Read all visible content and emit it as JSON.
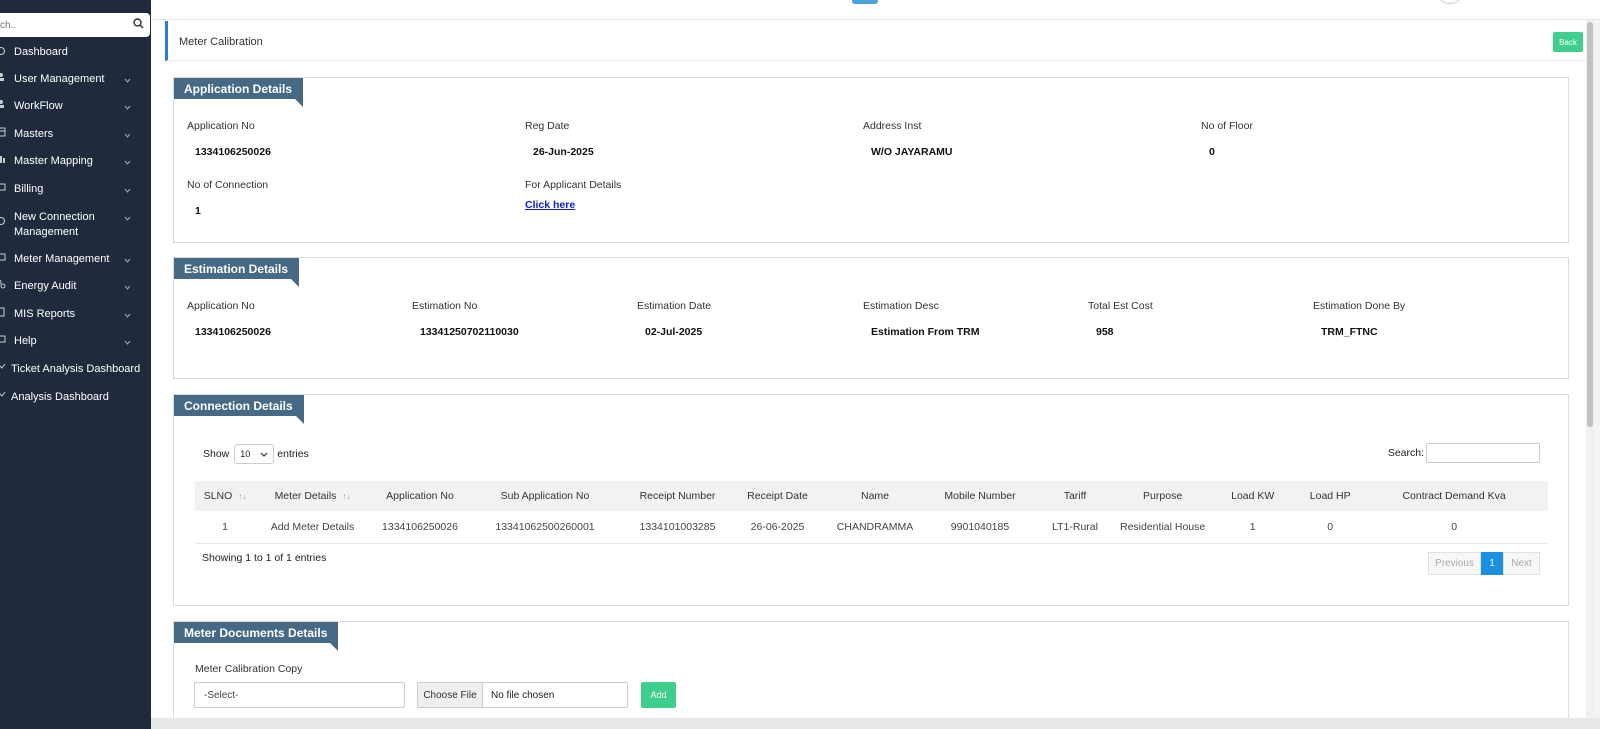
{
  "sidebar": {
    "search_placeholder": "ch..",
    "items": [
      {
        "label": "Dashboard",
        "icon": "dashboard-icon",
        "chevron": false
      },
      {
        "label": "User Management",
        "icon": "users-icon",
        "chevron": true
      },
      {
        "label": "WorkFlow",
        "icon": "workflow-icon",
        "chevron": true
      },
      {
        "label": "Masters",
        "icon": "table-icon",
        "chevron": true
      },
      {
        "label": "Master Mapping",
        "icon": "mapping-icon",
        "chevron": true
      },
      {
        "label": "Billing",
        "icon": "billing-icon",
        "chevron": true
      },
      {
        "label": "New Connection Management",
        "icon": "connection-icon",
        "chevron": true
      },
      {
        "label": "Meter Management",
        "icon": "meter-icon",
        "chevron": true
      },
      {
        "label": "Energy Audit",
        "icon": "audit-icon",
        "chevron": true
      },
      {
        "label": "MIS Reports",
        "icon": "reports-icon",
        "chevron": true
      },
      {
        "label": "Help",
        "icon": "help-icon",
        "chevron": true
      },
      {
        "label": "Ticket Analysis Dashboard",
        "icon": "ticket-icon",
        "chevron": false
      },
      {
        "label": "Analysis Dashboard",
        "icon": "chart-icon",
        "chevron": false
      }
    ]
  },
  "page": {
    "title": "Meter Calibration",
    "back_label": "Back"
  },
  "application": {
    "header": "Application Details",
    "app_no_label": "Application No",
    "app_no": "1334106250026",
    "reg_date_label": "Reg Date",
    "reg_date": "26-Jun-2025",
    "address_label": "Address Inst",
    "address": "W/O JAYARAMU",
    "floor_label": "No of Floor",
    "floor": "0",
    "conn_label": "No of Connection",
    "conn": "1",
    "applicant_label": "For Applicant Details",
    "applicant_link": "Click here"
  },
  "estimation": {
    "header": "Estimation Details",
    "app_no_label": "Application No",
    "app_no": "1334106250026",
    "est_no_label": "Estimation No",
    "est_no": "13341250702110030",
    "est_date_label": "Estimation Date",
    "est_date": "02-Jul-2025",
    "desc_label": "Estimation Desc",
    "desc": "Estimation From TRM",
    "cost_label": "Total Est Cost",
    "cost": "958",
    "done_by_label": "Estimation Done By",
    "done_by": "TRM_FTNC"
  },
  "connection": {
    "header": "Connection Details",
    "show_label": "Show",
    "entries_value": "10",
    "entries_label": "entries",
    "search_label": "Search:",
    "columns": [
      "SLNO",
      "Meter Details",
      "Application No",
      "Sub Application No",
      "Receipt Number",
      "Receipt Date",
      "Name",
      "Mobile Number",
      "Tariff",
      "Purpose",
      "Load KW",
      "Load HP",
      "Contract Demand Kva"
    ],
    "rows": [
      [
        "1",
        "Add Meter Details",
        "1334106250026",
        "13341062500260001",
        "1334101003285",
        "26-06-2025",
        "CHANDRAMMA",
        "9901040185",
        "LT1-Rural",
        "Residential House",
        "1",
        "0",
        "0"
      ]
    ],
    "info": "Showing 1 to 1 of 1 entries",
    "prev_label": "Previous",
    "page": "1",
    "next_label": "Next"
  },
  "documents": {
    "header": "Meter Documents Details",
    "label": "Meter Calibration Copy",
    "select_value": "-Select-",
    "file_button": "Choose File",
    "file_status": "No file chosen",
    "add_label": "Add"
  },
  "colors": {
    "sidebar_bg": "#1f2b3d",
    "section_header": "#466985",
    "success": "#3ecf8e",
    "pager_active": "#1b8fe0",
    "link_red": "#e02424"
  }
}
